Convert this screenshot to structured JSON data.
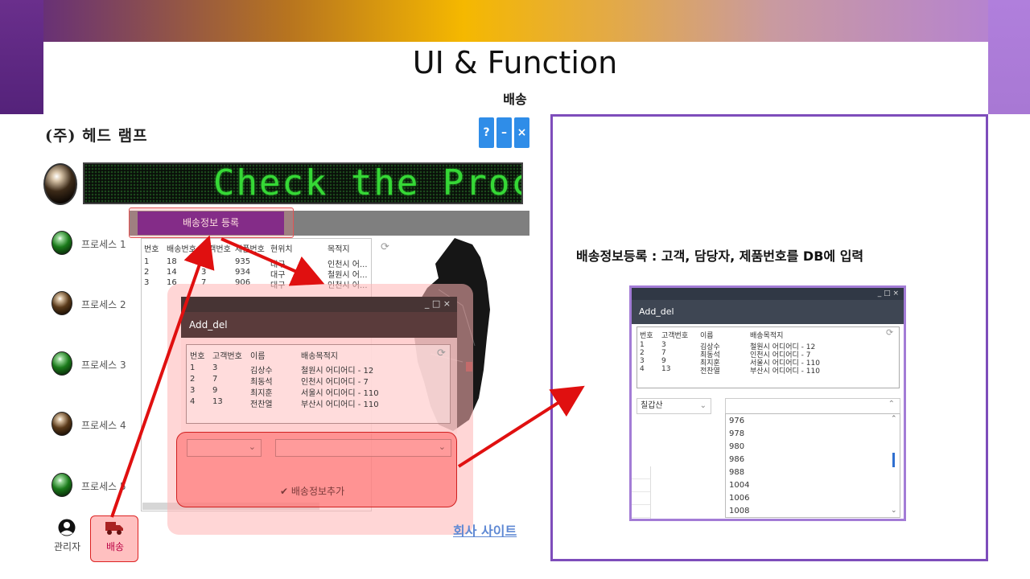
{
  "slide": {
    "title": "UI & Function",
    "subtitle": "배송"
  },
  "app": {
    "company": "(주) 헤드 램프",
    "window_buttons": [
      "?",
      "–",
      "×"
    ],
    "marquee": "Check the Process",
    "tabs": [
      {
        "label": "배송정보 등록",
        "active": true
      }
    ],
    "processes": [
      "프로세스 1",
      "프로세스 2",
      "프로세스 3",
      "프로세스 4",
      "프로세스 5"
    ],
    "list": {
      "headers": [
        "번호",
        "배송번호",
        "고객번호",
        "제품번호",
        "현위치",
        "목적지"
      ],
      "rows": [
        [
          "1",
          "18",
          "7",
          "935",
          "대구",
          "인천시 어..."
        ],
        [
          "2",
          "14",
          "3",
          "934",
          "대구",
          "철원시 어..."
        ],
        [
          "3",
          "16",
          "7",
          "906",
          "대구",
          "인천시 어..."
        ]
      ]
    },
    "nav": [
      {
        "label": "관리자",
        "icon": "user-icon"
      },
      {
        "label": "배송",
        "icon": "truck-icon"
      }
    ],
    "site_link": "회사 사이트"
  },
  "dialog": {
    "window_controls": "_ □ ×",
    "title": "Add_del",
    "headers": [
      "번호",
      "고객번호",
      "이름",
      "배송목적지"
    ],
    "rows": [
      [
        "1",
        "3",
        "김상수",
        "철원시 어디어디 - 12"
      ],
      [
        "2",
        "7",
        "최동석",
        "인천시 어디어디 - 7"
      ],
      [
        "3",
        "9",
        "최지훈",
        "서울시 어디어디 - 110"
      ],
      [
        "4",
        "13",
        "전찬열",
        "부산시 어디어디 - 110"
      ]
    ],
    "add_button": "배송정보추가"
  },
  "panel": {
    "description": "배송정보등록 :  고객, 담당자, 제품번호를 DB에 입력",
    "shot": {
      "window_controls": "_ □ ×",
      "title": "Add_del",
      "headers": [
        "번호",
        "고객번호",
        "이름",
        "배송목적지"
      ],
      "rows": [
        [
          "1",
          "3",
          "김상수",
          "철원시 어디어디 - 12"
        ],
        [
          "2",
          "7",
          "최동석",
          "인천시 어디어디 - 7"
        ],
        [
          "3",
          "9",
          "최지훈",
          "서울시 어디어디 - 110"
        ],
        [
          "4",
          "13",
          "전찬열",
          "부산시 어디어디 - 110"
        ]
      ],
      "combo_selected": "칠갑산",
      "dropdown_options": [
        "976",
        "978",
        "980",
        "986",
        "988",
        "1004",
        "1006",
        "1008"
      ]
    }
  },
  "colors": {
    "accent_purple": "#5b0f8a",
    "panel_border": "#7e4dbb",
    "arrow_red": "#e01010",
    "led_green": "#36d836"
  }
}
